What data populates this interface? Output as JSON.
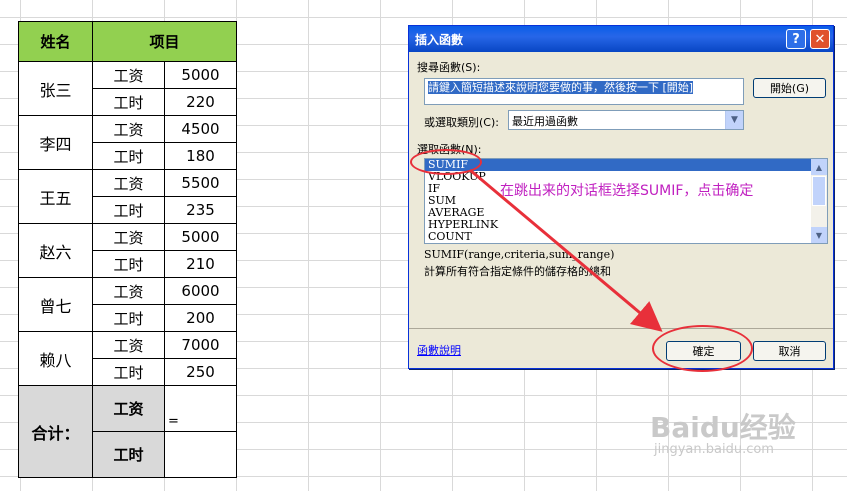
{
  "table": {
    "header_name": "姓名",
    "header_item": "项目",
    "people": [
      {
        "name": "张三",
        "rows": [
          {
            "item": "工资",
            "value": "5000"
          },
          {
            "item": "工时",
            "value": "220"
          }
        ]
      },
      {
        "name": "李四",
        "rows": [
          {
            "item": "工资",
            "value": "4500"
          },
          {
            "item": "工时",
            "value": "180"
          }
        ]
      },
      {
        "name": "王五",
        "rows": [
          {
            "item": "工资",
            "value": "5500"
          },
          {
            "item": "工时",
            "value": "235"
          }
        ]
      },
      {
        "name": "赵六",
        "rows": [
          {
            "item": "工资",
            "value": "5000"
          },
          {
            "item": "工时",
            "value": "210"
          }
        ]
      },
      {
        "name": "曾七",
        "rows": [
          {
            "item": "工资",
            "value": "6000"
          },
          {
            "item": "工时",
            "value": "200"
          }
        ]
      },
      {
        "name": "赖八",
        "rows": [
          {
            "item": "工资",
            "value": "7000"
          },
          {
            "item": "工时",
            "value": "250"
          }
        ]
      }
    ],
    "total_label": "合计：",
    "total_rows": [
      {
        "item": "工资",
        "value": "="
      },
      {
        "item": "工时",
        "value": ""
      }
    ]
  },
  "dialog": {
    "title": "插入函數",
    "help_label": "?",
    "close_label": "✕",
    "search_label": "搜尋函數(S):",
    "search_text": "請鍵入簡短描述來說明您要做的事，然後按一下 [開始]",
    "go_button": "開始(G)",
    "category_label": "或選取類別(C):",
    "category_value": "最近用過函數",
    "select_label": "選取函數(N):",
    "functions": [
      "SUMIF",
      "VLOOKUP",
      "IF",
      "SUM",
      "AVERAGE",
      "HYPERLINK",
      "COUNT"
    ],
    "selected_function": "SUMIF",
    "signature": "SUMIF(range,criteria,sum_range)",
    "description": "計算所有符合指定條件的儲存格的總和",
    "help_link": "函數說明",
    "ok_button": "確定",
    "cancel_button": "取消"
  },
  "annotation": {
    "text": "在跳出来的对话框选择SUMIF，点击确定",
    "color": "#c020c0",
    "arrow_color": "#e8303a"
  },
  "watermark": {
    "main": "Baidu经验",
    "sub": "jingyan.baidu.com"
  }
}
